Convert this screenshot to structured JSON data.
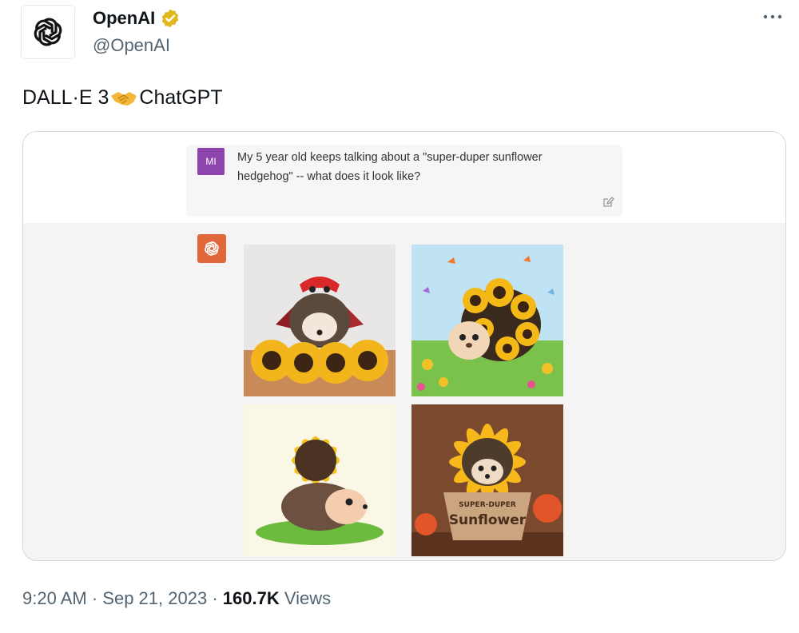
{
  "tweet": {
    "author": {
      "display_name": "OpenAI",
      "handle": "@OpenAI",
      "verified": true,
      "avatar_icon": "openai-logo-icon",
      "verified_icon": "verified-badge-icon"
    },
    "more_icon": "more-options-icon",
    "text_before": "DALL·E 3",
    "emoji_icon": "handshake-emoji",
    "text_after": "ChatGPT",
    "footer": {
      "time": "9:20 AM",
      "sep1": "·",
      "date": "Sep 21, 2023",
      "sep2": "·",
      "views_count": "160.7K",
      "views_label": "Views"
    }
  },
  "chat_card": {
    "user_badge": "MI",
    "user_badge_color": "#8e44ad",
    "user_prompt": "My 5 year old keeps talking about a \"super-duper sunflower hedgehog\" -- what does it look like?",
    "edit_icon": "edit-icon",
    "assistant_icon": "chatgpt-logo-icon",
    "assistant_badge_color": "#e0683a",
    "images": [
      {
        "name": "hedgehog-with-mask-on-sunflowers-image"
      },
      {
        "name": "hedgehog-sunflower-meadow-butterflies-image"
      },
      {
        "name": "hedgehog-sunflower-illustration-image"
      },
      {
        "name": "hedgehog-in-sunflower-pot-image",
        "pot_text_line1": "SUPER-DUPER",
        "pot_text_line2": "Sunflower"
      }
    ]
  },
  "colors": {
    "text_primary": "#0f1419",
    "text_secondary": "#536471",
    "verified_gold": "#e2b719",
    "card_border": "#cfd9de"
  }
}
